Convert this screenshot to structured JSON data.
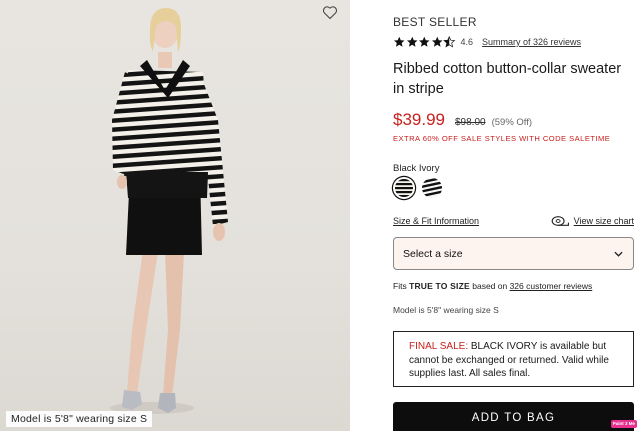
{
  "photo": {
    "caption": "Model is 5'8\" wearing size S",
    "favorite_icon": "heart-outline-icon"
  },
  "product": {
    "eyebrow": "BEST SELLER",
    "rating": {
      "value": "4.6",
      "stars": 4.5,
      "max_stars": 5,
      "reviews_link": "Summary of 326 reviews"
    },
    "title": "Ribbed cotton button-collar sweater in stripe",
    "price": {
      "sale": "$39.99",
      "original": "$98.00",
      "percent_off": "(59% Off)"
    },
    "promo": "EXTRA 60% OFF SALE STYLES WITH CODE SALETIME",
    "color": {
      "label": "Black Ivory",
      "swatches": [
        "Black Ivory",
        "Black White Stripe"
      ],
      "selected_index": 0
    },
    "size": {
      "fit_info_link": "Size & Fit Information",
      "chart_link": "View size chart",
      "select_value": "Select a size",
      "fits_prefix": "Fits ",
      "fits_value": "TRUE TO SIZE",
      "fits_middle": " based on ",
      "fits_reviews_link": "326 customer reviews",
      "model_note": "Model is 5'8\" wearing size S"
    },
    "final_sale": {
      "label": "FINAL SALE:",
      "text": " BLACK IVORY is available but cannot be exchanged or returned. Valid while supplies last. All sales final."
    },
    "add_to_bag_label": "ADD TO BAG",
    "badge": "Paint 3 Me"
  },
  "colors": {
    "sale_red": "#c8201e",
    "button_black": "#0d0d0d",
    "select_bg": "#fdf4ef"
  }
}
